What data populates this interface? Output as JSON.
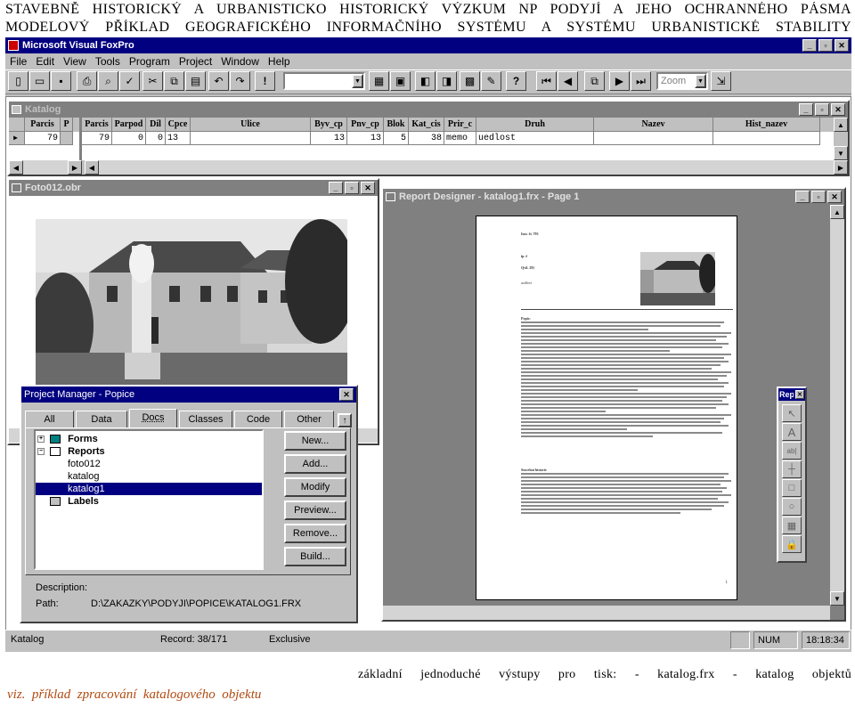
{
  "heading": {
    "line1": "STAVEBNĚ HISTORICKÝ A URBANISTICKO HISTORICKÝ VÝZKUM NP PODYJÍ A JEHO OCHRANNÉHO PÁSMA",
    "line2": "MODELOVÝ PŘÍKLAD GEOGRAFICKÉHO INFORMAČNÍHO SYSTÉMU A SYSTÉMU URBANISTICKÉ STABILITY"
  },
  "app": {
    "title": "Microsoft Visual FoxPro",
    "menu": [
      "File",
      "Edit",
      "View",
      "Tools",
      "Program",
      "Project",
      "Window",
      "Help"
    ],
    "toolbar": {
      "zoom_value": "Zoom"
    }
  },
  "catalog": {
    "title": "Katalog",
    "columns_left": [
      "Parcis",
      "P"
    ],
    "columns": [
      "Parcis",
      "Parpod",
      "Díl",
      "Cpce",
      "Ulice",
      "Byv_cp",
      "Pnv_cp",
      "Blok",
      "Kat_cis",
      "Prir_c",
      "Druh",
      "Nazev",
      "Hist_nazev"
    ],
    "row_left": [
      "79",
      ""
    ],
    "row": [
      "79",
      "0",
      "0",
      "13",
      "",
      "13",
      "13",
      "5",
      "38",
      "memo",
      "uedlost",
      "",
      ""
    ]
  },
  "photo_window": {
    "title": "Foto012.obr"
  },
  "report_designer": {
    "title": "Report Designer - katalog1.frx - Page 1",
    "page": {
      "line1": "Inst. ři. 793",
      "line2": "ip. ě",
      "line3": "Qvil. 29}",
      "line4": "uzdloví",
      "section1": "Popis:",
      "section2": "Stavební historie",
      "page_number": "1"
    }
  },
  "report_controls": {
    "title": "Rep"
  },
  "project_manager": {
    "title": "Project Manager - Popice",
    "tabs": [
      "All",
      "Data",
      "Docs",
      "Classes",
      "Code",
      "Other"
    ],
    "tree": [
      "Forms",
      "Reports",
      "foto012",
      "katalog",
      "katalog1",
      "Labels"
    ],
    "buttons": [
      "New...",
      "Add...",
      "Modify",
      "Preview...",
      "Remove...",
      "Build..."
    ],
    "description_label": "Description:",
    "path_label": "Path:",
    "path_value": "D:\\ZAKAZKY\\PODYJI\\POPICE\\KATALOG1.FRX"
  },
  "statusbar": {
    "table": "Katalog",
    "record": "Record: 38/171",
    "mode": "Exclusive",
    "num": "NUM",
    "time": "18:18:34"
  },
  "caption": {
    "right": "základní jednoduché výstupy pro tisk: - katalog.frx - katalog objektů",
    "left": "viz.  příklad  zpracování  katalogového  objektu"
  }
}
